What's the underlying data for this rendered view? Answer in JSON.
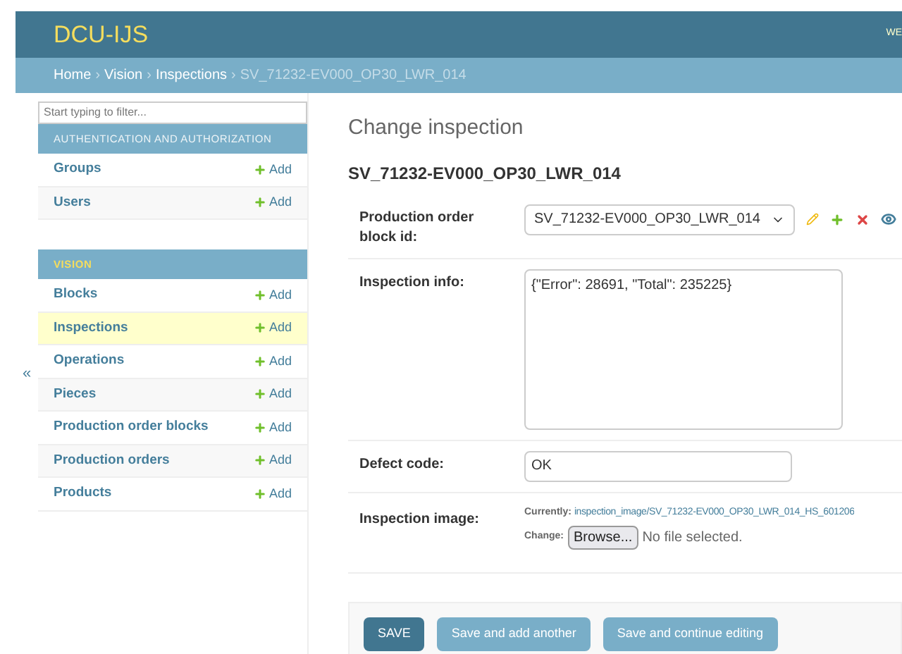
{
  "header": {
    "brand": "DCU-IJS",
    "user_tools": "WE"
  },
  "breadcrumb_separator": "›",
  "breadcrumbs": [
    {
      "label": "Home",
      "kind": "link"
    },
    {
      "label": "Vision",
      "kind": "link"
    },
    {
      "label": "Inspections",
      "kind": "link"
    },
    {
      "label": "SV_71232-EV000_OP30_LWR_014",
      "kind": "current"
    }
  ],
  "sidebar": {
    "filter_placeholder": "Start typing to filter...",
    "collapse_toggle": "«",
    "apps": [
      {
        "name": "AUTHENTICATION AND AUTHORIZATION",
        "selected": false,
        "models": [
          {
            "name": "Groups",
            "add": "Add",
            "selected": false
          },
          {
            "name": "Users",
            "add": "Add",
            "selected": false
          }
        ]
      },
      {
        "name": "VISION",
        "selected": true,
        "models": [
          {
            "name": "Blocks",
            "add": "Add",
            "selected": false
          },
          {
            "name": "Inspections",
            "add": "Add",
            "selected": true
          },
          {
            "name": "Operations",
            "add": "Add",
            "selected": false
          },
          {
            "name": "Pieces",
            "add": "Add",
            "selected": false
          },
          {
            "name": "Production order blocks",
            "add": "Add",
            "selected": false
          },
          {
            "name": "Production orders",
            "add": "Add",
            "selected": false
          },
          {
            "name": "Products",
            "add": "Add",
            "selected": false
          }
        ]
      }
    ]
  },
  "content": {
    "title": "Change inspection",
    "object_title": "SV_71232-EV000_OP30_LWR_014",
    "fields": [
      {
        "kind": "select",
        "label": "Production order block id:",
        "value": "SV_71232-EV000_OP30_LWR_014"
      },
      {
        "kind": "textarea",
        "label": "Inspection info:",
        "value": "{\"Error\": 28691, \"Total\": 235225}"
      },
      {
        "kind": "text",
        "label": "Defect code:",
        "value": "OK"
      },
      {
        "kind": "file",
        "label": "Inspection image:",
        "currently_label": "Currently:",
        "currently_link": "inspection_image/SV_71232-EV000_OP30_LWR_014_HS_601206",
        "change_label": "Change:",
        "browse": "Browse...",
        "no_file": "No file selected."
      }
    ]
  },
  "buttons": [
    {
      "label": "SAVE",
      "kind": "primary"
    },
    {
      "label": "Save and add another",
      "kind": "secondary"
    },
    {
      "label": "Save and continue editing",
      "kind": "secondary"
    }
  ]
}
